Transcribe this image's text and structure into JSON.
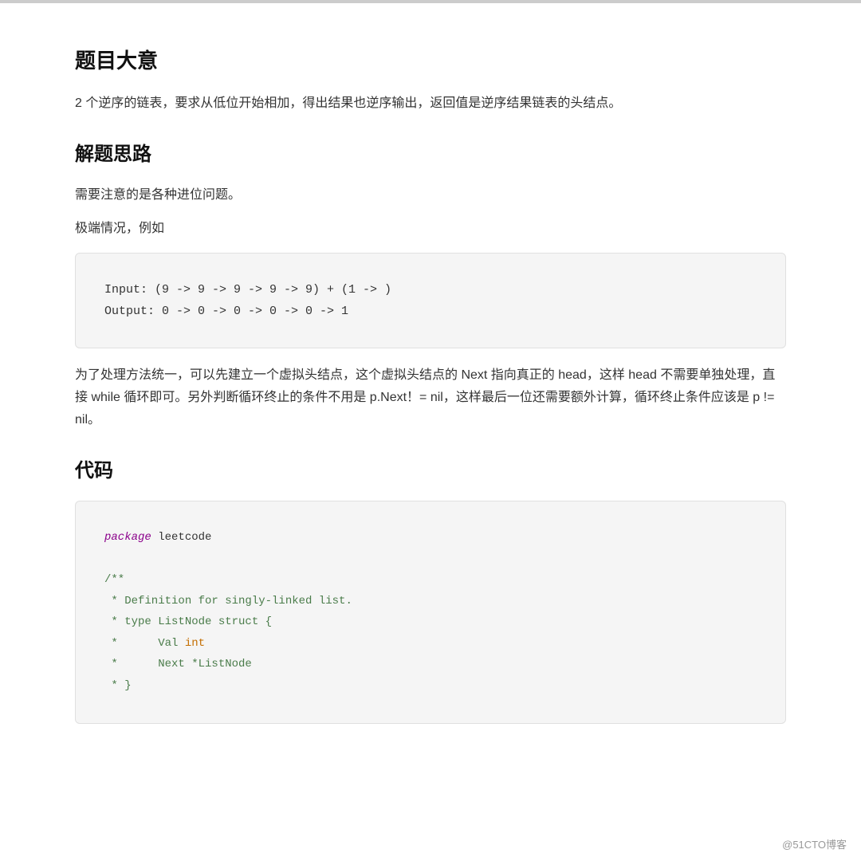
{
  "top_border": true,
  "sections": {
    "title1": "题目大意",
    "desc1": "2 个逆序的链表，要求从低位开始相加，得出结果也逆序输出，返回值是逆序结果链表的头结点。",
    "title2": "解题思路",
    "desc2a": "需要注意的是各种进位问题。",
    "desc2b": "极端情况，例如",
    "example_code": "Input: (9 -> 9 -> 9 -> 9 -> 9) + (1 -> )\nOutput: 0 -> 0 -> 0 -> 0 -> 0 -> 1",
    "desc3": "为了处理方法统一，可以先建立一个虚拟头结点，这个虚拟头结点的 Next 指向真正的 head，这样 head 不需要单独处理，直接 while 循环即可。另外判断循环终止的条件不用是 p.Next！= nil，这样最后一位还需要额外计算，循环终止条件应该是 p != nil。",
    "title3": "代码",
    "code_lines": [
      {
        "type": "keyword_purple",
        "text": "package",
        "rest": " leetcode"
      },
      {
        "type": "empty",
        "text": ""
      },
      {
        "type": "comment",
        "text": "/**"
      },
      {
        "type": "comment",
        "text": " * Definition for singly-linked list."
      },
      {
        "type": "comment",
        "text": " * type ListNode struct {"
      },
      {
        "type": "comment_with_keyword",
        "text": " *      Val ",
        "keyword": "int"
      },
      {
        "type": "comment",
        "text": " *      Next *ListNode"
      },
      {
        "type": "comment",
        "text": " * }"
      }
    ]
  },
  "watermark": "@51CTO博客"
}
